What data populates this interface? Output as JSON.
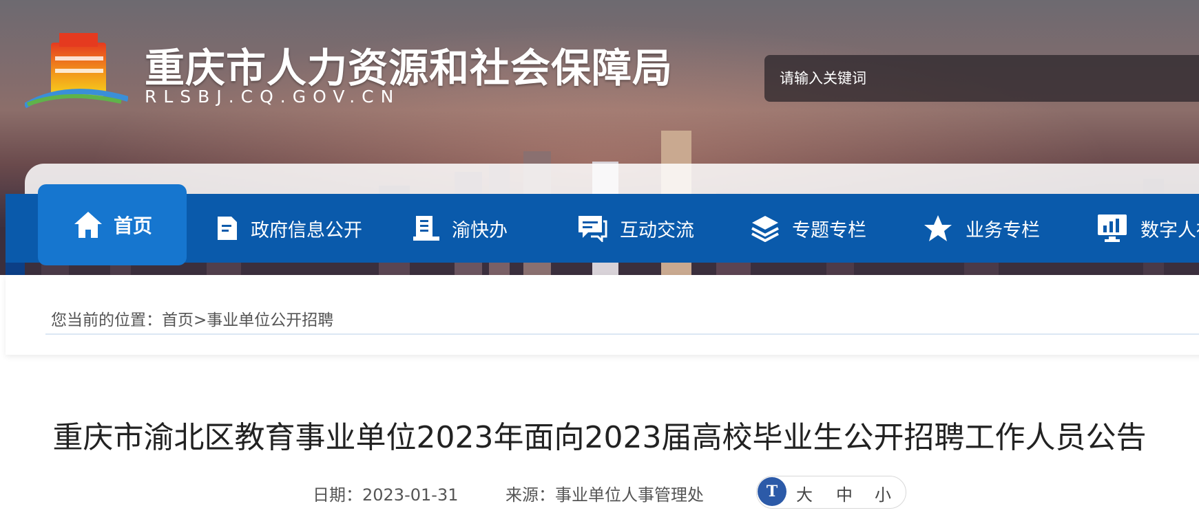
{
  "header": {
    "title": "重庆市人力资源和社会保障局",
    "domain": "RLSBJ.CQ.GOV.CN",
    "search_placeholder": "请输入关键词"
  },
  "nav": {
    "items": [
      {
        "label": "首页",
        "icon": "home-icon"
      },
      {
        "label": "政府信息公开",
        "icon": "document-icon"
      },
      {
        "label": "渝快办",
        "icon": "notebook-icon"
      },
      {
        "label": "互动交流",
        "icon": "chat-icon"
      },
      {
        "label": "专题专栏",
        "icon": "layers-icon"
      },
      {
        "label": "业务专栏",
        "icon": "star-icon"
      },
      {
        "label": "数字人社",
        "icon": "monitor-chart-icon"
      }
    ]
  },
  "breadcrumb": {
    "prefix": "您当前的位置：",
    "home": "首页",
    "separator": ">",
    "current": "事业单位公开招聘"
  },
  "article": {
    "title": "重庆市渝北区教育事业单位2023年面向2023届高校毕业生公开招聘工作人员公告",
    "date_label": "日期：",
    "date": "2023-01-31",
    "source_label": "来源：",
    "source": "事业单位人事管理处"
  },
  "font_size": {
    "icon": "text-size-icon",
    "icon_text": "T",
    "large": "大",
    "medium": "中",
    "small": "小"
  },
  "colors": {
    "nav_bg": "#0a5aab",
    "nav_active": "#1676cf",
    "text_dark": "#222222"
  }
}
